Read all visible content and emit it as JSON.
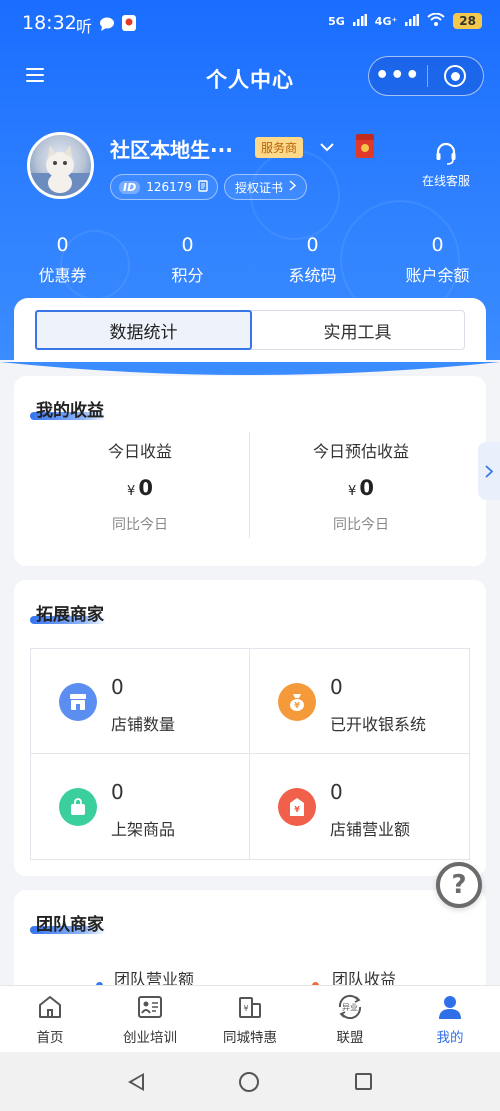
{
  "status_bar": {
    "time": "18:32",
    "app_glyph": "听",
    "network": "5G",
    "network2": "4G⁺",
    "battery": "28"
  },
  "header": {
    "title": "个人中心",
    "more_label": "•••"
  },
  "profile": {
    "name": "社区本地生···",
    "role_badge": "服务商",
    "id_tag": "ID",
    "id_value": "126179",
    "cert_label": "授权证书",
    "service_label": "在线客服"
  },
  "stats": [
    {
      "value": "0",
      "label": "优惠券"
    },
    {
      "value": "0",
      "label": "积分"
    },
    {
      "value": "0",
      "label": "系统码"
    },
    {
      "value": "0",
      "label": "账户余额"
    }
  ],
  "tabs": [
    {
      "label": "数据统计",
      "active": true
    },
    {
      "label": "实用工具",
      "active": false
    }
  ],
  "earnings": {
    "title": "我的收益",
    "currency": "¥",
    "items": [
      {
        "label": "今日收益",
        "value": "0",
        "sub": "同比今日"
      },
      {
        "label": "今日预估收益",
        "value": "0",
        "sub": "同比今日"
      }
    ]
  },
  "expand": {
    "title": "拓展商家",
    "items": [
      {
        "value": "0",
        "label": "店铺数量",
        "icon": "store-icon",
        "color": "#5b8ef0"
      },
      {
        "value": "0",
        "label": "已开收银系统",
        "icon": "money-bag-icon",
        "color": "#f59a3a"
      },
      {
        "value": "0",
        "label": "上架商品",
        "icon": "shopping-bag-icon",
        "color": "#3ccf9e"
      },
      {
        "value": "0",
        "label": "店铺营业额",
        "icon": "revenue-tag-icon",
        "color": "#f0604a"
      }
    ]
  },
  "team": {
    "title": "团队商家",
    "items": [
      {
        "label": "团队营业额",
        "dot_color": "#3574f0"
      },
      {
        "label": "团队收益",
        "dot_color": "#f06a3a"
      }
    ]
  },
  "bottom_tabs": [
    {
      "label": "首页",
      "icon": "home-icon",
      "active": false
    },
    {
      "label": "创业培训",
      "icon": "training-icon",
      "active": false
    },
    {
      "label": "同城特惠",
      "icon": "city-deals-icon",
      "active": false
    },
    {
      "label": "联盟",
      "icon": "alliance-icon",
      "active": false,
      "icon_text": "异业"
    },
    {
      "label": "我的",
      "icon": "profile-icon",
      "active": true
    }
  ],
  "colors": {
    "primary": "#1a6dff",
    "accent_active": "#2f6fe8"
  }
}
